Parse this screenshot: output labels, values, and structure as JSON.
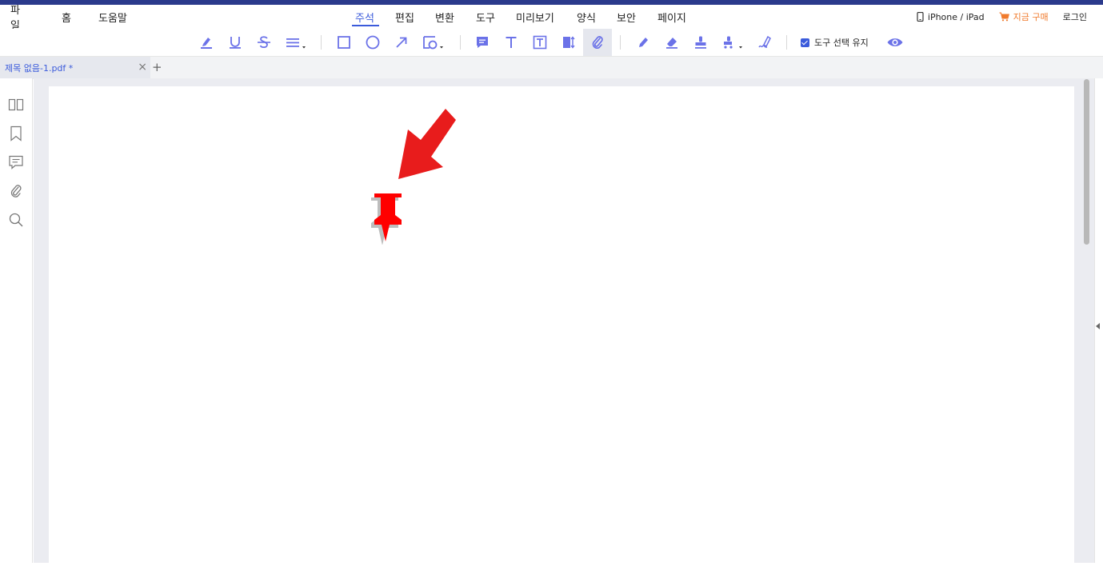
{
  "menu": {
    "file": "파일",
    "home": "홈",
    "help": "도움말",
    "tabs": [
      "주석",
      "편집",
      "변환",
      "도구",
      "미리보기",
      "양식",
      "보안",
      "페이지"
    ],
    "active_tab": "주석",
    "device_link": "iPhone / iPad",
    "buy_now": "지금 구매",
    "login": "로그인"
  },
  "toolbar": {
    "tools": [
      "highlight-icon",
      "underline-icon",
      "strikethrough-icon",
      "line-style-icon",
      "rectangle-icon",
      "ellipse-icon",
      "arrow-icon",
      "shape-dropdown-icon",
      "note-icon",
      "text-icon",
      "textbox-icon",
      "callout-icon",
      "attachment-icon",
      "pencil-icon",
      "eraser-icon",
      "stamp-icon",
      "stamp-dropdown-icon",
      "signature-icon"
    ],
    "selected_tool": "attachment-icon",
    "keep_tool_selected": "도구 선택 유지",
    "keep_tool_checked": true
  },
  "document_tab": {
    "name": "제목 없음-1.pdf *",
    "close": "×",
    "new_tab": "+"
  },
  "colors": {
    "accent": "#3b5bdb",
    "tool_icon": "#6b72e8",
    "top_strip": "#2b3a8c",
    "buy": "#f07a2c",
    "annotation_red": "#e81c1c",
    "canvas_bg": "#ebecf1"
  }
}
